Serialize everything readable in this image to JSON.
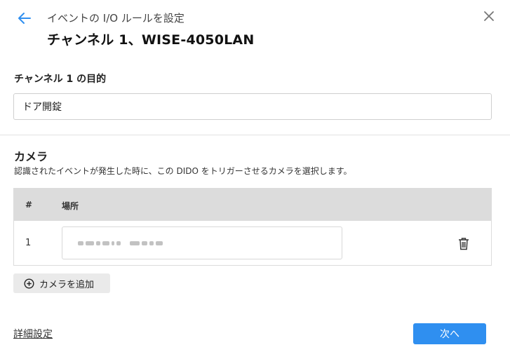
{
  "header": {
    "subtitle": "イベントの I/O ルールを設定",
    "title": "チャンネル 1、WISE-4050LAN",
    "back_icon": "arrow-left-icon",
    "close_icon": "close-icon"
  },
  "purpose": {
    "label": "チャンネル 1 の目的",
    "value": "ドア開錠"
  },
  "camera": {
    "title": "カメラ",
    "description": "認識されたイベントが発生した時に、この DIDO をトリガーさせるカメラを選択します。",
    "table": {
      "columns": [
        "#",
        "場所"
      ],
      "rows": [
        {
          "num": "1",
          "location_icon": "redacted-text"
        }
      ]
    },
    "delete_icon": "trash-icon",
    "add_button_label": "カメラを追加",
    "add_icon": "plus-circle-icon"
  },
  "footer": {
    "advanced_label": "詳細設定",
    "next_label": "次へ"
  },
  "colors": {
    "accent": "#2f8ff0",
    "table_header": "#dcdcdc",
    "add_button_bg": "#eaeaea"
  }
}
